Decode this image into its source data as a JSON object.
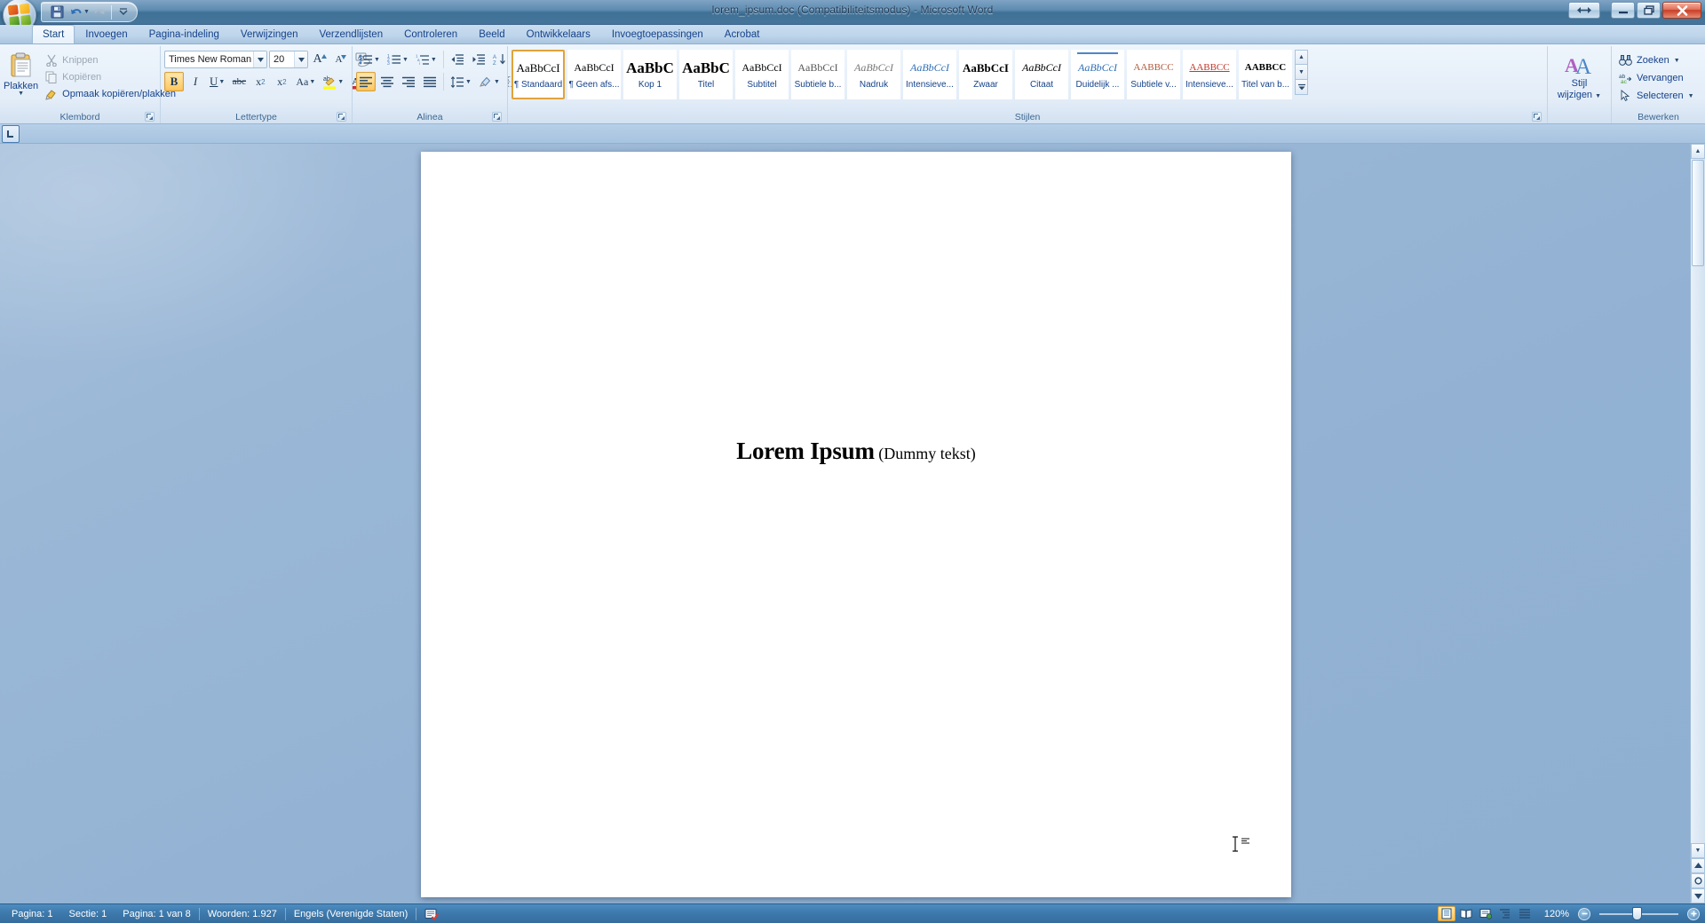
{
  "window": {
    "title": "lorem_ipsum.doc (Compatibiliteitsmodus) - Microsoft Word",
    "office_button": "Office",
    "restore_size_label": "Formaat wijzigen",
    "minimize_label": "Minimaliseren",
    "maximize_label": "Maximaliseren",
    "close_label": "Sluiten"
  },
  "quick_access": {
    "save": "Opslaan",
    "undo": "Ongedaan maken",
    "redo": "Opnieuw",
    "customize": "Werkbalk Snelle toegang aanpassen"
  },
  "tabs": [
    {
      "label": "Start",
      "active": true
    },
    {
      "label": "Invoegen",
      "active": false
    },
    {
      "label": "Pagina-indeling",
      "active": false
    },
    {
      "label": "Verwijzingen",
      "active": false
    },
    {
      "label": "Verzendlijsten",
      "active": false
    },
    {
      "label": "Controleren",
      "active": false
    },
    {
      "label": "Beeld",
      "active": false
    },
    {
      "label": "Ontwikkelaars",
      "active": false
    },
    {
      "label": "Invoegtoepassingen",
      "active": false
    },
    {
      "label": "Acrobat",
      "active": false
    }
  ],
  "ribbon": {
    "groups": {
      "clipboard": {
        "label": "Klembord",
        "paste": "Plakken",
        "cut": "Knippen",
        "copy": "Kopiëren",
        "format_painter": "Opmaak kopiëren/plakken"
      },
      "font": {
        "label": "Lettertype",
        "font_name": "Times New Roman",
        "font_size": "20",
        "grow_font": "Tekst vergroten",
        "shrink_font": "Tekst verkleinen",
        "clear_formatting": "Opmaak wissen",
        "bold": "B",
        "italic": "I",
        "underline": "U",
        "strikethrough": "abc",
        "subscript": "x₂",
        "superscript": "x²",
        "change_case": "Aa",
        "highlight": "Tekstmarkeringskleur",
        "font_color": "Tekstkleur"
      },
      "paragraph": {
        "label": "Alinea",
        "bullets": "Opsommingstekens",
        "numbering": "Nummering",
        "multilevel": "Lijst met meerdere niveaus",
        "decrease_indent": "Inspringing verkleinen",
        "increase_indent": "Inspringing vergroten",
        "sort": "Sorteren",
        "show_marks": "¶",
        "align_left": "Links uitlijnen",
        "align_center": "Centreren",
        "align_right": "Rechts uitlijnen",
        "justify": "Uitvullen",
        "line_spacing": "Regelafstand",
        "shading": "Arcering",
        "borders": "Randen"
      },
      "styles": {
        "label": "Stijlen",
        "items": [
          {
            "preview": "AaBbCcI",
            "name": "¶ Standaard",
            "selected": true
          },
          {
            "preview": "AaBbCcI",
            "name": "¶ Geen afs...",
            "selected": false
          },
          {
            "preview": "AaBbC",
            "name": "Kop 1",
            "selected": false
          },
          {
            "preview": "AaBbC",
            "name": "Titel",
            "selected": false
          },
          {
            "preview": "AaBbCcI",
            "name": "Subtitel",
            "selected": false
          },
          {
            "preview": "AaBbCcI",
            "name": "Subtiele b...",
            "selected": false
          },
          {
            "preview": "AaBbCcI",
            "name": "Nadruk",
            "selected": false
          },
          {
            "preview": "AaBbCcI",
            "name": "Intensieve...",
            "selected": false
          },
          {
            "preview": "AaBbCcI",
            "name": "Zwaar",
            "selected": false
          },
          {
            "preview": "AaBbCcI",
            "name": "Citaat",
            "selected": false
          },
          {
            "preview": "AaBbCcI",
            "name": "Duidelijk ...",
            "selected": false
          },
          {
            "preview": "AABBCC",
            "name": "Subtiele v...",
            "selected": false
          },
          {
            "preview": "AABBCC",
            "name": "Intensieve...",
            "selected": false
          },
          {
            "preview": "AABBCC",
            "name": "Titel van b...",
            "selected": false
          }
        ],
        "scroll_up": "Omhoog",
        "scroll_down": "Omlaag",
        "more": "Meer"
      },
      "change_styles": {
        "label_line1": "Stijl",
        "label_line2": "wijzigen"
      },
      "editing": {
        "label": "Bewerken",
        "find": "Zoeken",
        "replace": "Vervangen",
        "select": "Selecteren"
      }
    }
  },
  "ruler": {
    "tab_selector": "Tabstop links"
  },
  "document": {
    "title_bold": "Lorem Ipsum",
    "title_rest": " (Dummy tekst)"
  },
  "status_bar": {
    "page": "Pagina: 1",
    "section": "Sectie: 1",
    "page_of": "Pagina: 1 van 8",
    "words": "Woorden: 1.927",
    "language": "Engels (Verenigde Staten)",
    "proofing_icon": "spelling-check-icon",
    "views": [
      {
        "name": "print-layout-view",
        "active": true
      },
      {
        "name": "full-screen-reading-view",
        "active": false
      },
      {
        "name": "web-layout-view",
        "active": false
      },
      {
        "name": "outline-view",
        "active": false
      },
      {
        "name": "draft-view",
        "active": false
      }
    ],
    "zoom": "120%",
    "zoom_out": "−",
    "zoom_in": "+"
  },
  "colors": {
    "title_bar": "#45759a",
    "ribbon_bg": "#e3edf8",
    "accent_text": "#15428b",
    "selected_style_border": "#e0a33c",
    "status_bar": "#3f7bae",
    "workspace_bg": "#93b2d3"
  }
}
